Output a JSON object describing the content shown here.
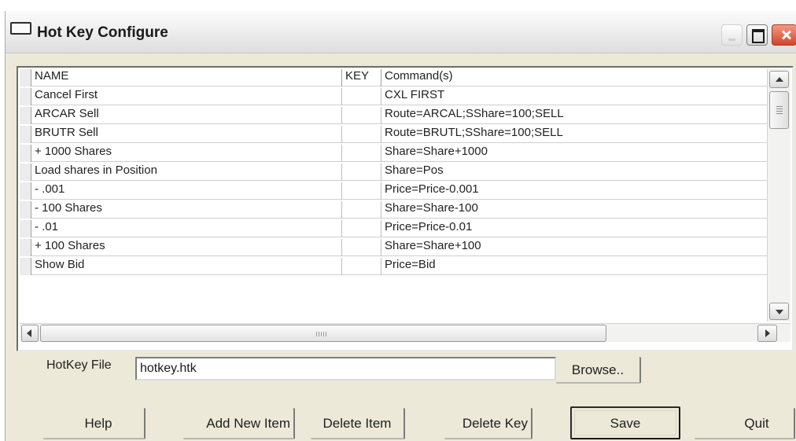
{
  "window": {
    "title": "Hot Key Configure"
  },
  "grid": {
    "columns": [
      "NAME",
      "KEY",
      "Command(s)"
    ],
    "rows": [
      {
        "name": "Cancel First",
        "key": "",
        "command": "CXL FIRST"
      },
      {
        "name": "ARCAR Sell",
        "key": "",
        "command": "Route=ARCAL;SShare=100;SELL"
      },
      {
        "name": "BRUTR Sell",
        "key": "",
        "command": "Route=BRUTL;SShare=100;SELL"
      },
      {
        "name": "+ 1000 Shares",
        "key": "",
        "command": "Share=Share+1000"
      },
      {
        "name": "Load shares in Position",
        "key": "",
        "command": "Share=Pos"
      },
      {
        "name": "- .001",
        "key": "",
        "command": "Price=Price-0.001"
      },
      {
        "name": "- 100 Shares",
        "key": "",
        "command": "Share=Share-100"
      },
      {
        "name": "- .01",
        "key": "",
        "command": "Price=Price-0.01"
      },
      {
        "name": "+ 100 Shares",
        "key": "",
        "command": "Share=Share+100"
      },
      {
        "name": "Show Bid",
        "key": "",
        "command": "Price=Bid"
      }
    ]
  },
  "hotkey_file": {
    "label": "HotKey File",
    "value": "hotkey.htk"
  },
  "buttons": {
    "browse": "Browse..",
    "help": "Help",
    "add_new_item": "Add New Item",
    "delete_item": "Delete Item",
    "delete_key": "Delete Key",
    "save": "Save",
    "quit": "Quit"
  }
}
